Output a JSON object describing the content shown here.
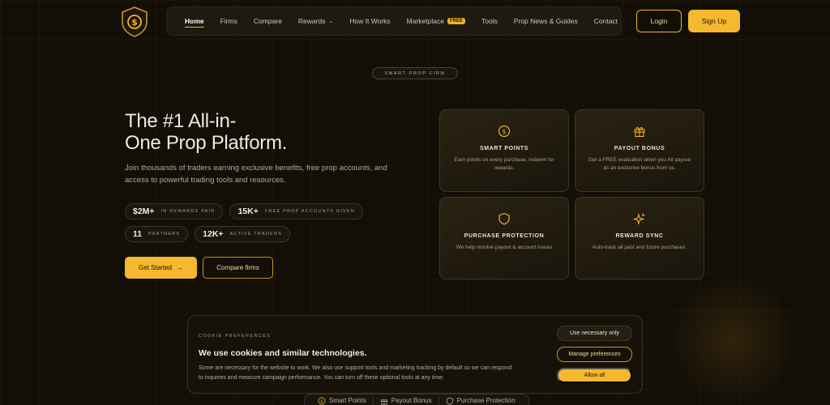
{
  "colors": {
    "accent": "#f5b82e",
    "background": "#130f07",
    "text": "#efe9dc"
  },
  "header": {
    "nav": [
      {
        "label": "Home",
        "active": true
      },
      {
        "label": "Firms"
      },
      {
        "label": "Compare"
      },
      {
        "label": "Rewards",
        "has_dropdown": true
      },
      {
        "label": "How It Works"
      },
      {
        "label": "Marketplace",
        "badge": "FREE"
      },
      {
        "label": "Tools"
      },
      {
        "label": "Prop News & Guides"
      },
      {
        "label": "Contact"
      }
    ],
    "login_label": "Login",
    "signup_label": "Sign Up"
  },
  "hero": {
    "eyebrow": "SMART PROP FIRM",
    "title_line1": "The #1 All-in-",
    "title_line2": "One Prop Platform.",
    "subtitle": "Join thousands of traders earning exclusive benefits, free prop accounts, and access to powerful trading tools and resources.",
    "stats": [
      {
        "num": "$2M+",
        "label": "IN REWARDS PAID"
      },
      {
        "num": "15K+",
        "label": "FREE PROP ACCOUNTS GIVEN"
      },
      {
        "num": "11",
        "label": "PARTNERS"
      },
      {
        "num": "12K+",
        "label": "ACTIVE TRADERS"
      }
    ],
    "primary_cta": "Get Started",
    "primary_cta_arrow": "→",
    "secondary_cta": "Compare firms"
  },
  "features": [
    {
      "icon": "dollar-coin-icon",
      "title": "SMART POINTS",
      "desc": "Earn points on every purchase, redeem for rewards."
    },
    {
      "icon": "gift-icon",
      "title": "PAYOUT BONUS",
      "desc": "Get a FREE evaluation when you hit payout as an exclusive bonus from us."
    },
    {
      "icon": "shield-icon",
      "title": "PURCHASE PROTECTION",
      "desc": "We help resolve payout & account issues"
    },
    {
      "icon": "sparkle-icon",
      "title": "REWARD SYNC",
      "desc": "Auto-track all past and future purchases."
    }
  ],
  "cookie": {
    "eyebrow": "COOKIE PREFERENCES",
    "title": "We use cookies and similar technologies.",
    "body": "Some are necessary for the website to work. We also use support tools and marketing tracking by default so we can respond to inquiries and measure campaign performance. You can turn off these optional tools at any time.",
    "btn_necessary": "Use necessary only",
    "btn_manage": "Manage preferences",
    "btn_allow": "Allow all"
  },
  "strip": [
    {
      "icon": "dollar-coin-icon",
      "label": "Smart Points"
    },
    {
      "icon": "gift-icon",
      "label": "Payout Bonus"
    },
    {
      "icon": "shield-icon",
      "label": "Purchase Protection"
    }
  ]
}
